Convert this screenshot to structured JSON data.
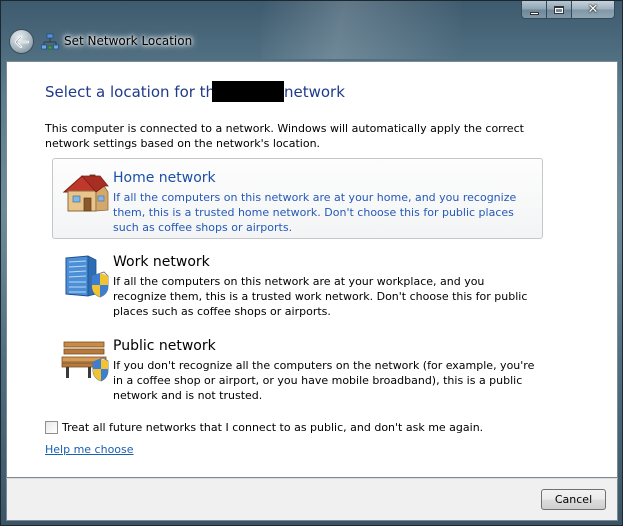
{
  "window": {
    "title": "Set Network Location",
    "close_glyph": "✕"
  },
  "content": {
    "heading_prefix": "Select a location for the",
    "heading_suffix": "network",
    "intro": "This computer is connected to a network. Windows will automatically apply the correct network settings based on the network's location."
  },
  "options": [
    {
      "title": "Home network",
      "description": "If all the computers on this network are at your home, and you recognize them, this is a trusted home network.  Don't choose this for public places such as coffee shops or airports.",
      "icon": "house-icon",
      "selected": true
    },
    {
      "title": "Work network",
      "description": "If all the computers on this network are at your workplace, and you recognize them, this is a trusted work network.  Don't choose this for public places such as coffee shops or airports.",
      "icon": "office-building-shield-icon",
      "selected": false
    },
    {
      "title": "Public network",
      "description": "If you don't recognize all the computers on the network (for example, you're in a coffee shop or airport, or you have mobile broadband), this is a public network and is not trusted.",
      "icon": "park-bench-shield-icon",
      "selected": false
    }
  ],
  "checkbox": {
    "label": "Treat all future networks that I connect to as public, and don't ask me again.",
    "checked": false
  },
  "help_link": "Help me choose",
  "footer": {
    "cancel_label": "Cancel"
  },
  "colors": {
    "heading": "#1e3b8a",
    "link": "#1a5fb4",
    "selected_text": "#2459b8"
  }
}
